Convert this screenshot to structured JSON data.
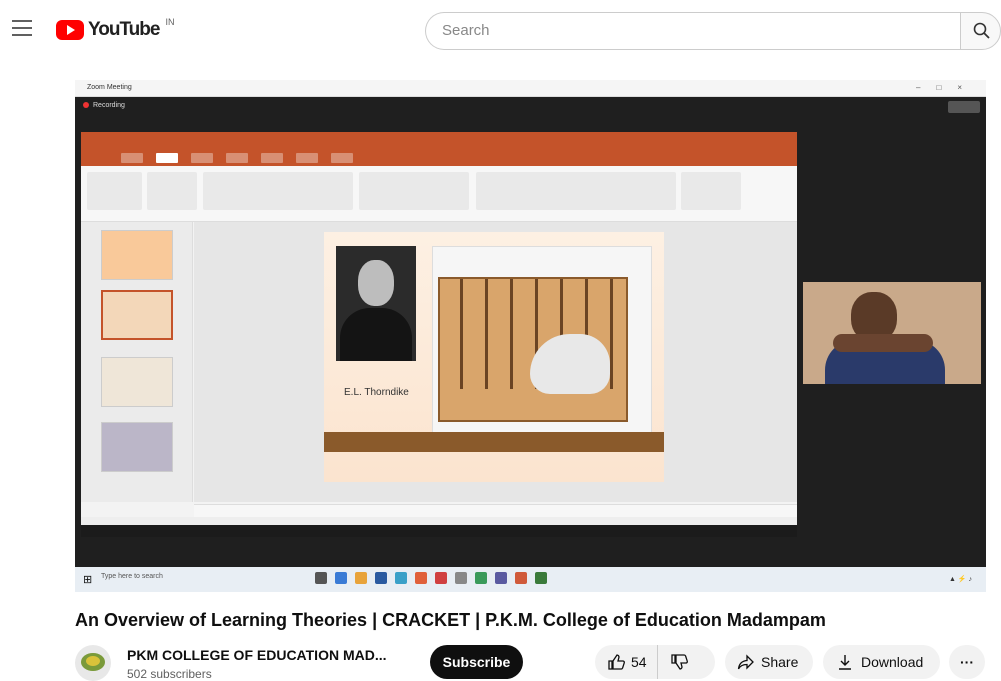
{
  "header": {
    "logo_text": "YouTube",
    "logo_sup": "IN",
    "search_placeholder": "Search"
  },
  "player": {
    "window_title": "Zoom Meeting",
    "recording_label": "Recording",
    "slide_caption": "E.L. Thorndike",
    "taskbar_search": "Type here to search"
  },
  "video": {
    "title": "An Overview of Learning Theories | CRACKET | P.K.M. College of Education Madampam"
  },
  "channel": {
    "name": "PKM COLLEGE OF EDUCATION MAD...",
    "subscribers": "502 subscribers",
    "subscribe_label": "Subscribe"
  },
  "actions": {
    "likes": "54",
    "share_label": "Share",
    "download_label": "Download",
    "more_label": "···"
  },
  "colors": {
    "accent": "#ff0000",
    "ppt_orange": "#c4532a"
  }
}
